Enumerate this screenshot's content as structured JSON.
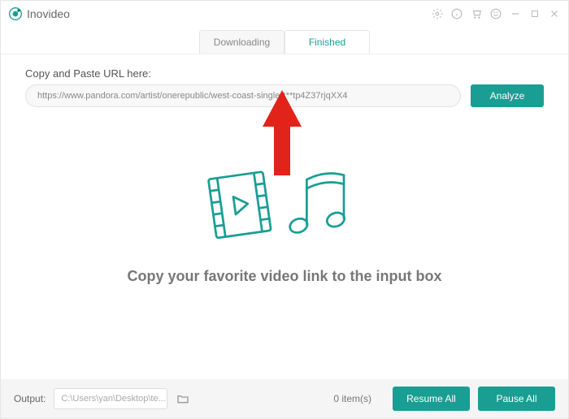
{
  "app": {
    "name": "Inovideo"
  },
  "tabs": {
    "downloading": "Downloading",
    "finished": "Finished"
  },
  "url_section": {
    "label": "Copy and Paste URL here:",
    "value": "https://www.pandora.com/artist/onerepublic/west-coast-single/***tp4Z37rjqXX4",
    "analyze": "Analyze"
  },
  "center": {
    "text": "Copy your favorite video link to the input box"
  },
  "bottom": {
    "output_label": "Output:",
    "path": "C:\\Users\\yan\\Desktop\\te...",
    "items": "0 item(s)",
    "resume": "Resume All",
    "pause": "Pause All"
  }
}
